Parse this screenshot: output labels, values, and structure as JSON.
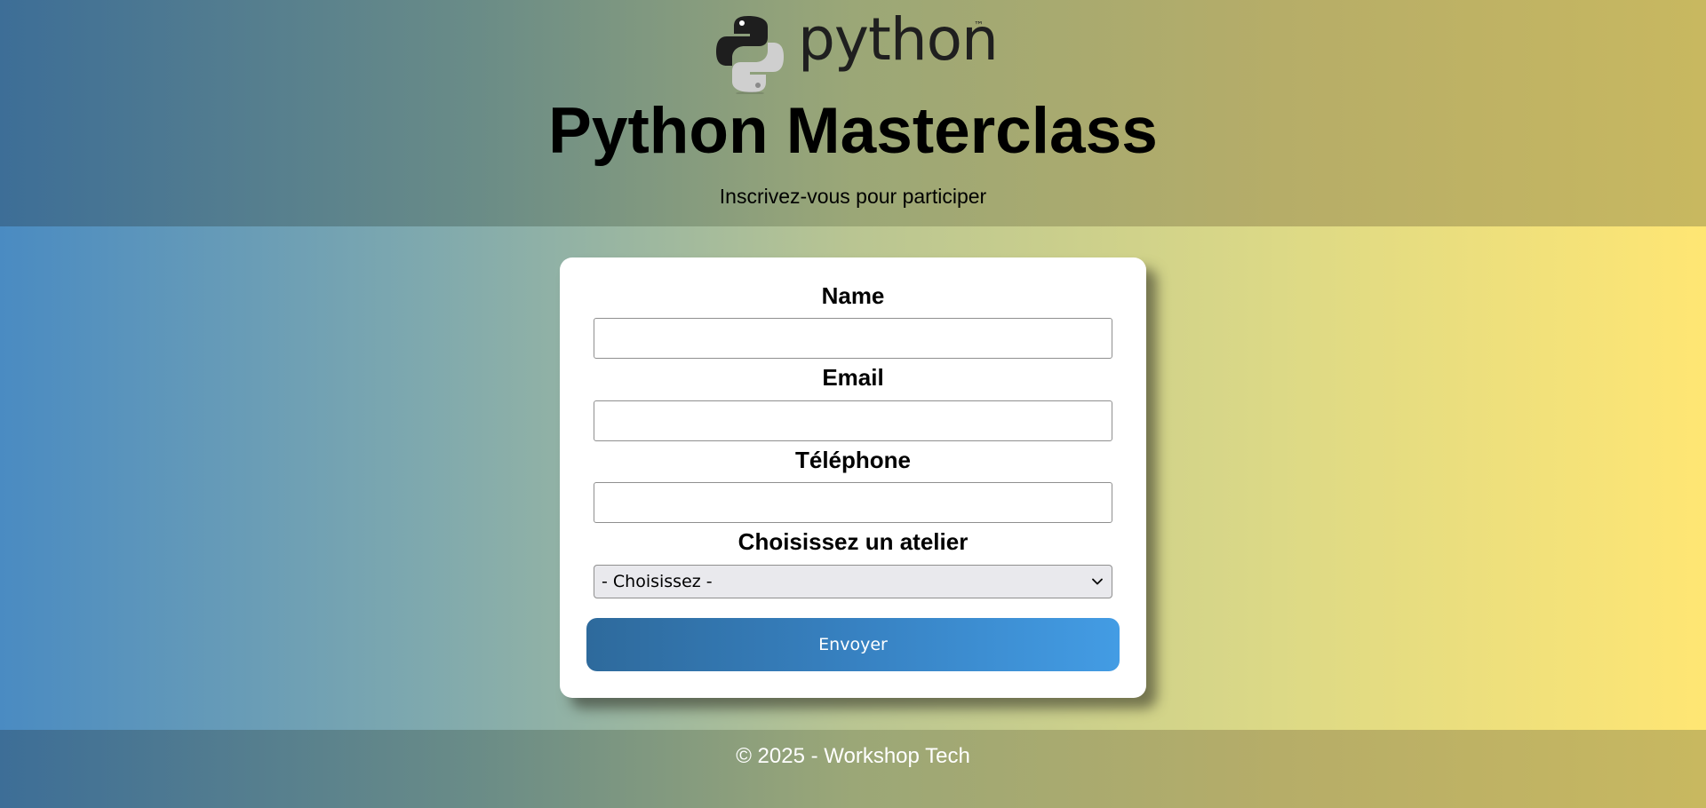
{
  "header": {
    "logo": {
      "wordmark": "python",
      "trademark": "™",
      "icon": "python-snake-logo"
    },
    "title": "Python Masterclass",
    "subtitle": "Inscrivez-vous pour participer"
  },
  "form": {
    "fields": [
      {
        "label": "Name",
        "value": ""
      },
      {
        "label": "Email",
        "value": ""
      },
      {
        "label": "Téléphone",
        "value": ""
      }
    ],
    "workshop": {
      "label": "Choisissez un atelier",
      "selected": "- Choisissez -",
      "icon": "chevron-down-icon"
    },
    "submit_label": "Envoyer"
  },
  "footer": {
    "text": "© 2025 - Workshop Tech"
  },
  "colors": {
    "button_start": "#2e6a9c",
    "button_end": "#439ce4",
    "python_blue": "#3776ab",
    "python_yellow": "#ffd43b"
  }
}
